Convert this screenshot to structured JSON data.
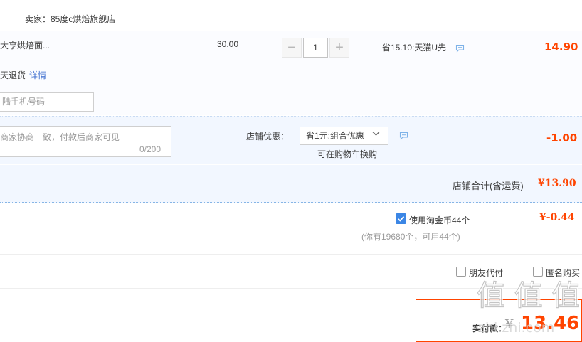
{
  "seller": {
    "label": "卖家：85度c烘焙旗舰店"
  },
  "item": {
    "name": "大亨烘焙面...",
    "unit_price": "30.00",
    "quantity": "1",
    "promotion": "省15.10:天猫U先",
    "total": "14.90",
    "return_policy": "天退货",
    "detail_link": "详情",
    "phone_placeholder": "陆手机号码"
  },
  "shop": {
    "message_placeholder": "商家协商一致，付款后商家可见",
    "message_count": "0/200",
    "discount_label": "店铺优惠：",
    "discount_selected": "省1元:组合优惠",
    "discount_hint": "可在购物车换购",
    "discount_value": "-1.00",
    "subtotal_label": "店铺合计(含运费)",
    "subtotal_value": "¥13.90"
  },
  "coins": {
    "label": "使用淘金币44个",
    "value": "¥-0.44",
    "note": "(你有19680个，可用44个)",
    "checked": true
  },
  "options": {
    "friend_pay": "朋友代付",
    "anonymous": "匿名购买"
  },
  "payment": {
    "label": "实付款：",
    "currency": "¥",
    "value": "13.46"
  },
  "watermark": {
    "logo_text": "值 值 值",
    "site": "zhi.zhi.com"
  },
  "colors": {
    "accent": "#ff4400",
    "link": "#3366cc",
    "checkbox": "#3b86e5",
    "row_bg": "#f2f7ff"
  },
  "icons": {
    "message": "chat-bubble-icon",
    "dropdown": "chevron-down-icon",
    "checkbox": "checkmark-icon"
  }
}
